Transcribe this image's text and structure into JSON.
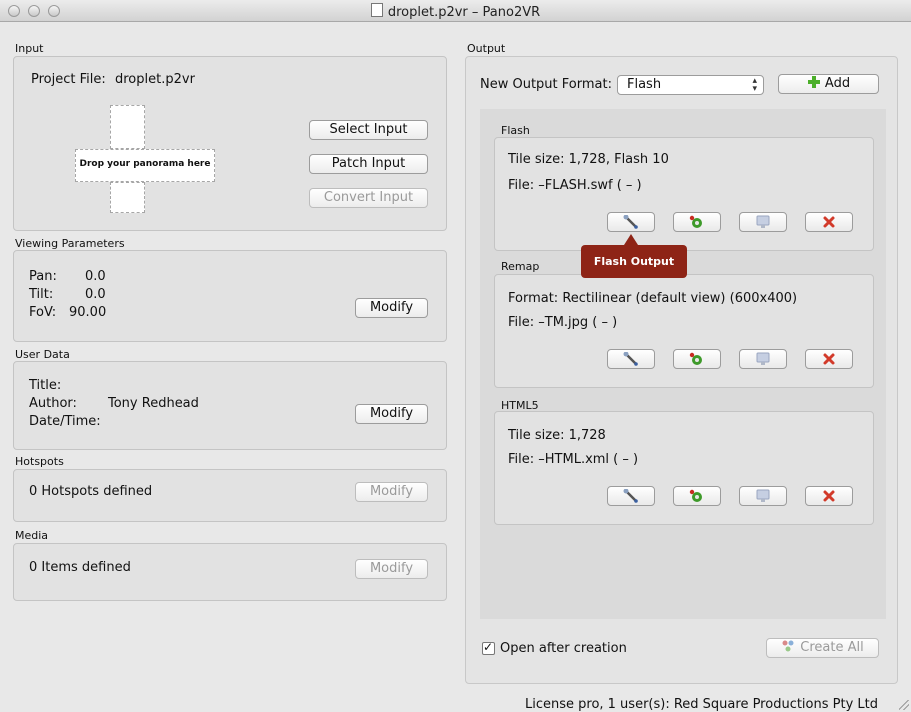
{
  "window": {
    "title": "droplet.p2vr  – Pano2VR"
  },
  "input": {
    "group_label": "Input",
    "project_file_label": "Project File:",
    "project_file_value": "droplet.p2vr",
    "drop_text": "Drop your panorama here",
    "select_input": "Select Input",
    "patch_input": "Patch Input",
    "convert_input": "Convert Input"
  },
  "viewing": {
    "group_label": "Viewing Parameters",
    "pan_label": "Pan:",
    "pan_value": "0.0",
    "tilt_label": "Tilt:",
    "tilt_value": "0.0",
    "fov_label": "FoV:",
    "fov_value": "90.00",
    "modify": "Modify"
  },
  "userdata": {
    "group_label": "User Data",
    "title_label": "Title:",
    "author_label": "Author:",
    "author_value": "Tony Redhead",
    "datetime_label": "Date/Time:",
    "modify": "Modify"
  },
  "hotspots": {
    "group_label": "Hotspots",
    "count_text": "0 Hotspots defined",
    "modify": "Modify"
  },
  "media": {
    "group_label": "Media",
    "count_text": "0 Items defined",
    "modify": "Modify"
  },
  "output": {
    "group_label": "Output",
    "new_format_label": "New Output Format:",
    "format_selected": "Flash",
    "add": "Add",
    "sections": [
      {
        "label": "Flash",
        "line1": "Tile size: 1,728, Flash 10",
        "line2": "File: –FLASH.swf ( – )"
      },
      {
        "label": "Remap",
        "line1": "Format: Rectilinear (default view) (600x400)",
        "line2": "File: –TM.jpg ( – )"
      },
      {
        "label": "HTML5",
        "line1": "Tile size: 1,728",
        "line2": "File: –HTML.xml ( – )"
      }
    ],
    "tooltip": "Flash Output",
    "open_after_creation": "Open after creation",
    "create_all": "Create All"
  },
  "status": {
    "license": "License pro, 1 user(s): Red Square Productions Pty Ltd"
  },
  "colors": {
    "tooltip": "#8e2416",
    "add_icon": "#4caf2a",
    "delete_icon": "#d23a2a"
  },
  "icons": [
    "wrench-icon",
    "gear-icon",
    "monitor-icon",
    "delete-icon",
    "add-icon",
    "create-all-icon"
  ]
}
